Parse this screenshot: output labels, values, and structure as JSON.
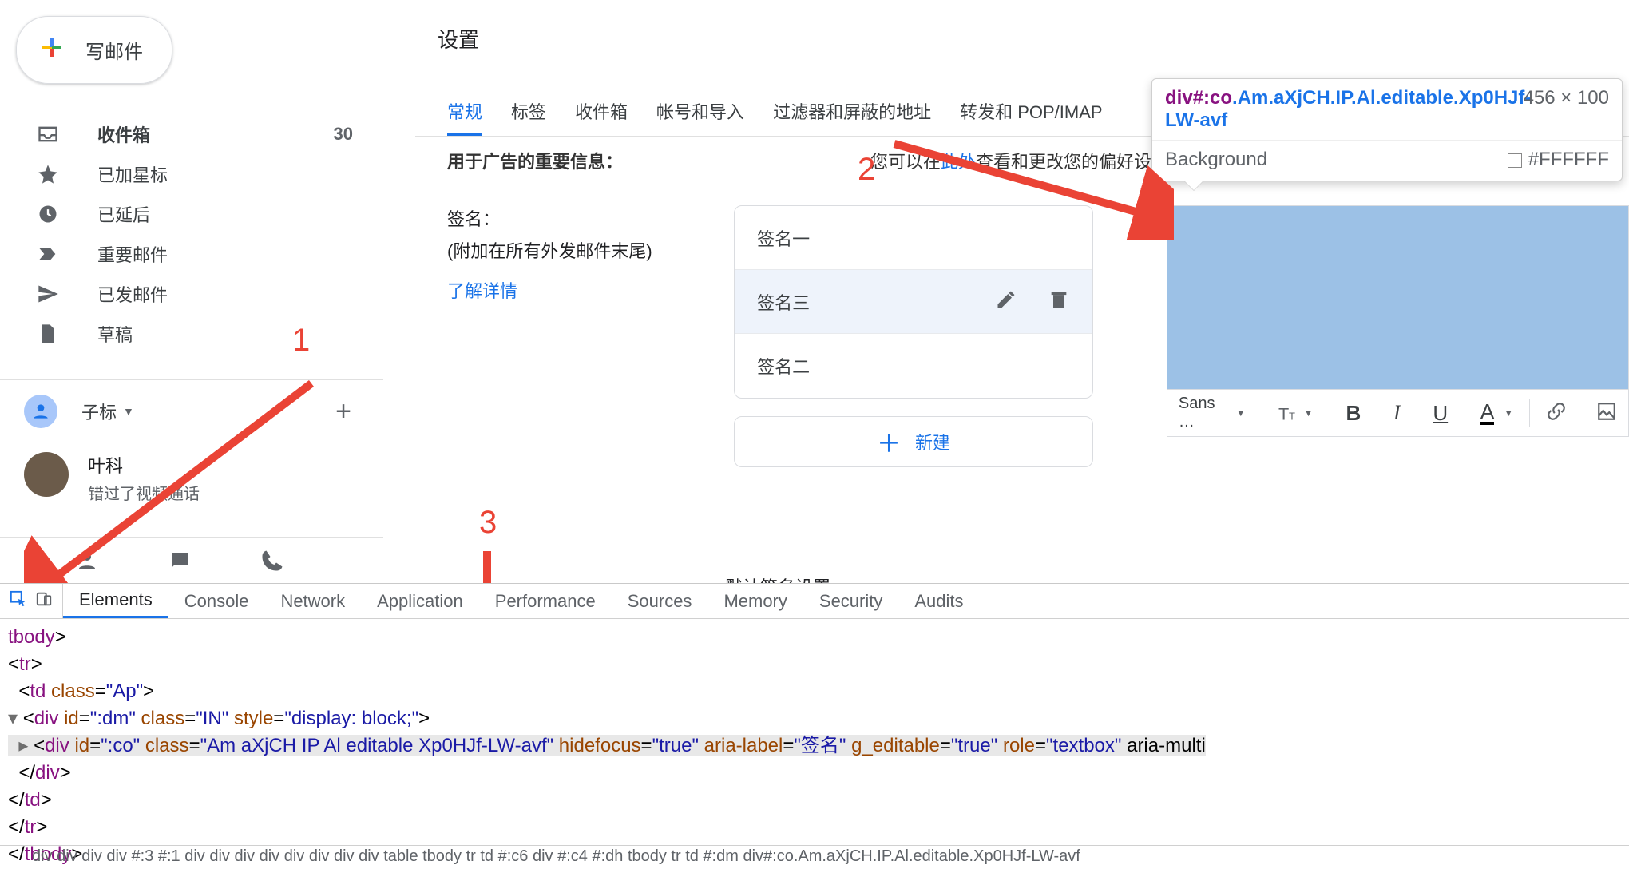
{
  "compose_label": "写邮件",
  "sidebar": {
    "items": [
      {
        "label": "收件箱",
        "count": "30"
      },
      {
        "label": "已加星标"
      },
      {
        "label": "已延后"
      },
      {
        "label": "重要邮件"
      },
      {
        "label": "已发邮件"
      },
      {
        "label": "草稿"
      }
    ],
    "labels_header": "子标",
    "chat": {
      "name": "叶科",
      "sub": "错过了视频通话"
    }
  },
  "page_title": "设置",
  "tabs": [
    "常规",
    "标签",
    "收件箱",
    "帐号和导入",
    "过滤器和屏蔽的地址",
    "转发和 POP/IMAP"
  ],
  "partial": {
    "frag1": "用于广告的重要信息：",
    "frag2_pre": "您可以在",
    "frag2_link": "此处",
    "frag2_post": "查看和更改您的偏好设置。"
  },
  "signature": {
    "title": "签名：",
    "sub": "(附加在所有外发邮件末尾)",
    "learn": "了解详情",
    "rows": [
      "签名一",
      "签名三",
      "签名二"
    ],
    "new": "新建",
    "font": "Sans …"
  },
  "truncated_heading": "默认签名设置",
  "annotations": {
    "n1": "1",
    "n2": "2",
    "n3": "3"
  },
  "tooltip": {
    "selector_prefix": "div",
    "selector_id": "#:co",
    "selector_classes": ".Am.aXjCH.IP.Al.editable.Xp0HJf-LW-avf",
    "dims": "456 × 100",
    "bg_label": "Background",
    "bg_value": "#FFFFFF"
  },
  "devtools": {
    "tabs": [
      "Elements",
      "Console",
      "Network",
      "Application",
      "Performance",
      "Sources",
      "Memory",
      "Security",
      "Audits"
    ],
    "dom_lines": [
      {
        "indent": 0,
        "raw_tag": "tbody",
        "close": false,
        "open_only": true
      },
      {
        "indent": 0,
        "raw": "<tr>"
      },
      {
        "indent": 1,
        "raw": "<td class=\"Ap\">"
      },
      {
        "indent": 0,
        "tri": "▾",
        "raw": "<div id=\":dm\" class=\"IN\" style=\"display: block;\">"
      },
      {
        "indent": 1,
        "tri": "▸",
        "hl": true,
        "raw": "<div id=\":co\" class=\"Am aXjCH IP Al editable Xp0HJf-LW-avf\" hidefocus=\"true\" aria-label=\"签名\" g_editable=\"true\" role=\"textbox\" aria-multi"
      },
      {
        "indent": 1,
        "raw": "</div>"
      },
      {
        "indent": 0,
        "raw": "</td>"
      },
      {
        "indent": 0,
        "raw": "</tr>"
      },
      {
        "indent": 0,
        "raw_tag": "tbody",
        "close": true
      }
    ],
    "crumbs": "div   div   div   div   #:3   #:1   div   div   div   div   div   div   div   div   table   tbody   tr   td   #:c6   div   #:c4   #:dh   tbody   tr   td   #:dm   div#:co.Am.aXjCH.IP.Al.editable.Xp0HJf-LW-avf"
  }
}
